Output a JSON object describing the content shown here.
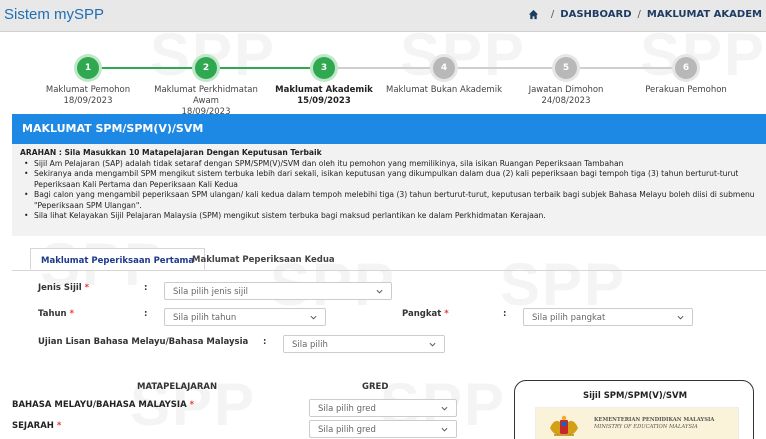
{
  "app": {
    "title": "Sistem mySPP",
    "breadcrumb": {
      "home_icon": "home-icon",
      "items": [
        "DASHBOARD",
        "MAKLUMAT AKADEM"
      ]
    }
  },
  "watermark": {
    "text": "SPP",
    "colors": {
      "watermark": "#000000"
    }
  },
  "stepper": {
    "steps": [
      {
        "number": "1",
        "label": "Maklumat Pemohon",
        "date": "18/09/2023",
        "status": "done"
      },
      {
        "number": "2",
        "label": "Maklumat Perkhidmatan Awam",
        "date": "18/09/2023",
        "status": "done"
      },
      {
        "number": "3",
        "label": "Maklumat Akademik",
        "date": "15/09/2023",
        "status": "current"
      },
      {
        "number": "4",
        "label": "Maklumat Bukan Akademik",
        "date": "",
        "status": "todo"
      },
      {
        "number": "5",
        "label": "Jawatan Dimohon",
        "date": "24/08/2023",
        "status": "todo"
      },
      {
        "number": "6",
        "label": "Perakuan Pemohon",
        "date": "",
        "status": "todo"
      }
    ],
    "colors": {
      "done": "#2fa84f",
      "todo": "#b8b8b8"
    }
  },
  "panel": {
    "title": "MAKLUMAT SPM/SPM(V)/SVM",
    "color": "#1e88e5"
  },
  "arahan": {
    "title": "ARAHAN : Sila Masukkan 10 Matapelajaran Dengan Keputusan Terbaik",
    "items": [
      "Sijil Am Pelajaran (SAP) adalah tidak setaraf dengan SPM/SPM(V)/SVM dan oleh itu pemohon yang memilikinya, sila isikan Ruangan Peperiksaan Tambahan",
      "Sekiranya anda mengambil SPM mengikut sistem terbuka lebih dari sekali, isikan keputusan yang dikumpulkan dalam dua (2) kali peperiksaan bagi tempoh tiga (3) tahun berturut-turut Peperiksaan Kali Pertama dan Peperiksaan Kali Kedua",
      "Bagi calon yang mengambil peperiksaan SPM ulangan/ kali kedua dalam tempoh melebihi tiga (3) tahun berturut-turut, keputusan terbaik bagi subjek Bahasa Melayu boleh diisi di submenu \"Peperiksaan SPM Ulangan\".",
      "Sila lihat Kelayakan Sijil Pelajaran Malaysia (SPM) mengikut sistem terbuka bagi maksud perlantikan ke dalam Perkhidmatan Kerajaan."
    ]
  },
  "tabs": [
    {
      "label": "Maklumat Peperiksaan Pertama",
      "active": true
    },
    {
      "label": "Maklumat Peperiksaan Kedua",
      "active": false
    }
  ],
  "form": {
    "jenis_sijil": {
      "label": "Jenis Sijil",
      "required": "*",
      "colon": ":",
      "placeholder": "Sila pilih jenis sijil"
    },
    "tahun": {
      "label": "Tahun",
      "required": "*",
      "colon": ":",
      "placeholder": "Sila pilih tahun"
    },
    "pangkat": {
      "label": "Pangkat",
      "required": "*",
      "colon": ":",
      "placeholder": "Sila pilih pangkat"
    },
    "ujian_lisan": {
      "label": "Ujian Lisan Bahasa Melayu/Bahasa Malaysia",
      "colon": ":",
      "placeholder": "Sila pilih"
    }
  },
  "subjects": {
    "header_subject": "MATAPELAJARAN",
    "header_grade": "GRED",
    "rows": [
      {
        "name": "BAHASA MELAYU/BAHASA MALAYSIA",
        "required": "*",
        "placeholder": "Sila pilih gred"
      },
      {
        "name": "SEJARAH",
        "required": "*",
        "placeholder": "Sila pilih gred"
      }
    ]
  },
  "certificate": {
    "title": "Sijil SPM/SPM(V)/SVM",
    "line1": "KEMENTERIAN PENDIDIKAN MALAYSIA",
    "line2": "MINISTRY OF EDUCATION MALAYSIA"
  }
}
